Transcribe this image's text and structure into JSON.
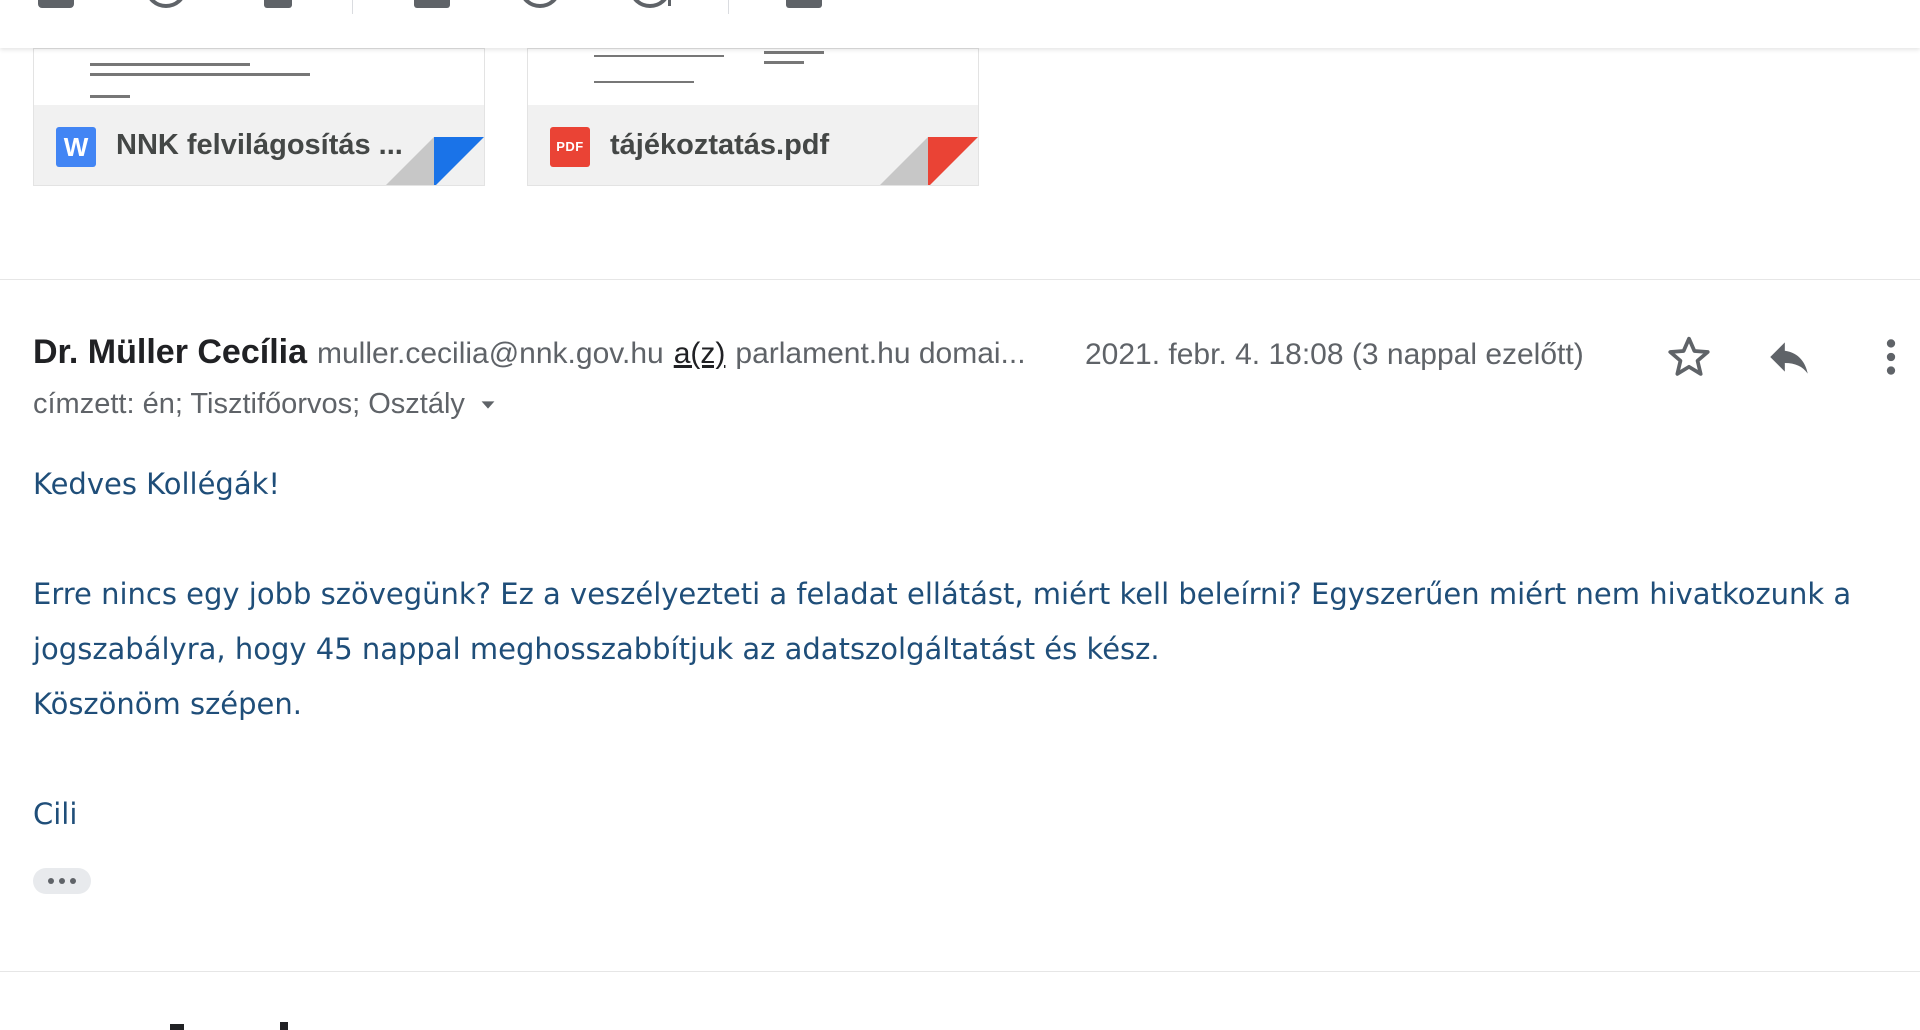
{
  "attachments": [
    {
      "name": "NNK felvilágosítás ...",
      "filetype_label": "W",
      "filetype": "word",
      "accent_color": "#1a73e8"
    },
    {
      "name": "tájékoztatás.pdf",
      "filetype_label": "PDF",
      "filetype": "pdf",
      "accent_color": "#ea4335"
    }
  ],
  "message": {
    "sender_name": "Dr. Müller Cecília",
    "sender_email": "muller.cecilia@nnk.gov.hu",
    "via_label": "a(z)",
    "via_domain": "parlament.hu domai...",
    "date": "2021. febr. 4. 18:08 (3 nappal ezelőtt)",
    "recipients": "címzett: én; Tisztifőorvos; Osztály",
    "body": {
      "greeting": "Kedves Kollégák!",
      "paragraph_line1": "Erre nincs egy jobb szövegünk? Ez a veszélyezteti a feladat ellátást, miért kell beleírni? Egyszerűen  miért nem hivatkozunk a",
      "paragraph_line2": "jogszabályra, hogy 45 nappal meghosszabbítjuk az adatszolgáltatást és kész.",
      "thanks": "Köszönöm szépen.",
      "signature": "Cili"
    }
  },
  "colors": {
    "body_text": "#1f4e79",
    "secondary_text": "#5f6368",
    "primary_text": "#202124"
  },
  "icons": {
    "star": "star-outline-icon",
    "reply": "reply-icon",
    "more": "more-vert-icon",
    "expand": "arrow-drop-down-icon",
    "show_trimmed": "more-horiz-icon"
  }
}
